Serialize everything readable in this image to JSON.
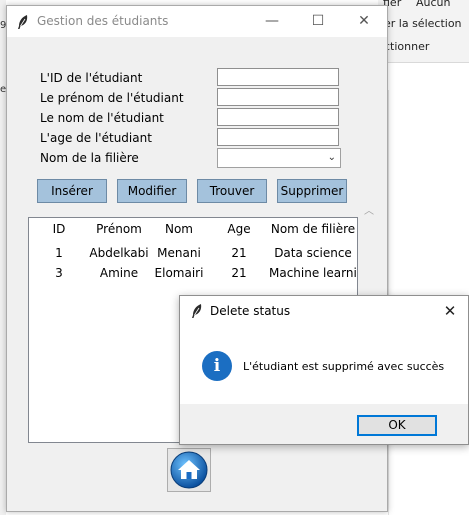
{
  "background": {
    "ribbon_line1": "ﬁer",
    "ribbon_item": "Aucun",
    "ribbon_line2": "er la sélection",
    "ribbon_line3": "ctionner",
    "left_fragment1": "9-",
    "left_fragment2": "e:"
  },
  "window": {
    "title": "Gestion des étudiants",
    "minimize_glyph": "—",
    "maximize_glyph": "☐",
    "close_glyph": "✕"
  },
  "form": {
    "id_label": "L'ID de l'étudiant",
    "firstname_label": "Le prénom de l'étudiant",
    "lastname_label": "Le nom de l'étudiant",
    "age_label": "L'age de l'étudiant",
    "filiere_label": "Nom de la filière",
    "id_value": "",
    "firstname_value": "",
    "lastname_value": "",
    "age_value": "",
    "filiere_value": "",
    "combo_arrow": "⌄"
  },
  "buttons": {
    "insert": "Insérer",
    "modify": "Modifier",
    "find": "Trouver",
    "delete": "Supprimer"
  },
  "table": {
    "columns": [
      "ID",
      "Prénom",
      "Nom",
      "Age",
      "Nom de filière"
    ],
    "rows": [
      [
        "1",
        "Abdelkabi",
        "Menani",
        "21",
        "Data science"
      ],
      [
        "3",
        "Amine",
        "Elomairi",
        "21",
        "Machine learnir"
      ]
    ]
  },
  "dialog": {
    "title": "Delete status",
    "message": "L'étudiant est supprimé avec succès",
    "ok_label": "OK",
    "close_glyph": "✕",
    "info_glyph": "i"
  },
  "colors": {
    "button_bg": "#a4c2dc",
    "info_blue": "#1b6ec2",
    "focus_border": "#0078d7"
  },
  "icons": {
    "window_icon": "feather-icon",
    "home_icon": "home-icon",
    "info_icon": "info-icon"
  }
}
